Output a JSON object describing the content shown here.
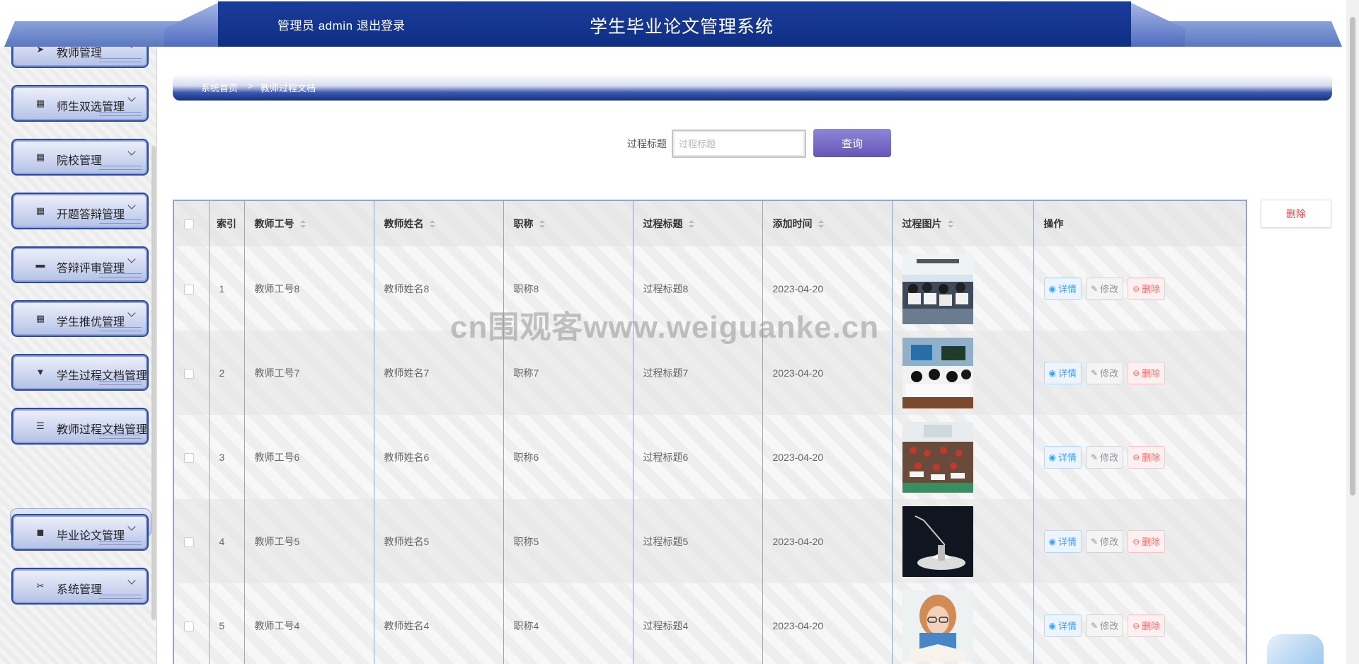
{
  "header": {
    "user": "管理员 admin",
    "logout": "退出登录",
    "title": "学生毕业论文管理系统"
  },
  "sidebar": {
    "items": [
      {
        "label": "教师管理",
        "icon": "send-icon"
      },
      {
        "label": "师生双选管理",
        "icon": "grid-icon"
      },
      {
        "label": "院校管理",
        "icon": "grid-icon"
      },
      {
        "label": "开题答辩管理",
        "icon": "grid-icon"
      },
      {
        "label": "答辩评审管理",
        "icon": "comment-icon"
      },
      {
        "label": "学生推优管理",
        "icon": "grid-icon"
      },
      {
        "label": "学生过程文档管理",
        "icon": "brush-icon"
      },
      {
        "label": "教师过程文档管理",
        "icon": "list-icon"
      },
      {
        "label": "毕业论文管理",
        "icon": "box-icon"
      },
      {
        "label": "系统管理",
        "icon": "ticket-icon"
      }
    ],
    "subitem": "教师过程文档"
  },
  "breadcrumb": {
    "home": "系统首页",
    "sep": ">",
    "current": "教师过程文档"
  },
  "search": {
    "label": "过程标题",
    "placeholder": "过程标题",
    "button": "查询"
  },
  "toolbar": {
    "delete": "删除"
  },
  "table": {
    "headers": {
      "index": "索引",
      "teacher_id": "教师工号",
      "teacher_name": "教师姓名",
      "title_rank": "职称",
      "process_title": "过程标题",
      "add_time": "添加时间",
      "image": "过程图片",
      "ops": "操作"
    },
    "rows": [
      {
        "index": "1",
        "teacher_id": "教师工号8",
        "teacher_name": "教师姓名8",
        "title_rank": "职称8",
        "process_title": "过程标题8",
        "add_time": "2023-04-20",
        "image": "classroom-photo-1"
      },
      {
        "index": "2",
        "teacher_id": "教师工号7",
        "teacher_name": "教师姓名7",
        "title_rank": "职称7",
        "process_title": "过程标题7",
        "add_time": "2023-04-20",
        "image": "classroom-photo-2"
      },
      {
        "index": "3",
        "teacher_id": "教师工号6",
        "teacher_name": "教师姓名6",
        "title_rank": "职称6",
        "process_title": "过程标题6",
        "add_time": "2023-04-20",
        "image": "classroom-photo-3"
      },
      {
        "index": "4",
        "teacher_id": "教师工号5",
        "teacher_name": "教师姓名5",
        "title_rank": "职称5",
        "process_title": "过程标题5",
        "add_time": "2023-04-20",
        "image": "desk-lamp-book-photo"
      },
      {
        "index": "5",
        "teacher_id": "教师工号4",
        "teacher_name": "教师姓名4",
        "title_rank": "职称4",
        "process_title": "过程标题4",
        "add_time": "2023-04-20",
        "image": "girl-reading-photo"
      }
    ],
    "ops": {
      "detail": "详情",
      "edit": "修改",
      "delete": "删除"
    }
  },
  "watermark": "cn围观客www.weiguanke.cn",
  "colors": {
    "header": "#0f2f86",
    "accent": "#6456b8",
    "border": "#93a3d4",
    "danger": "#f56c6c",
    "info": "#409eff"
  }
}
